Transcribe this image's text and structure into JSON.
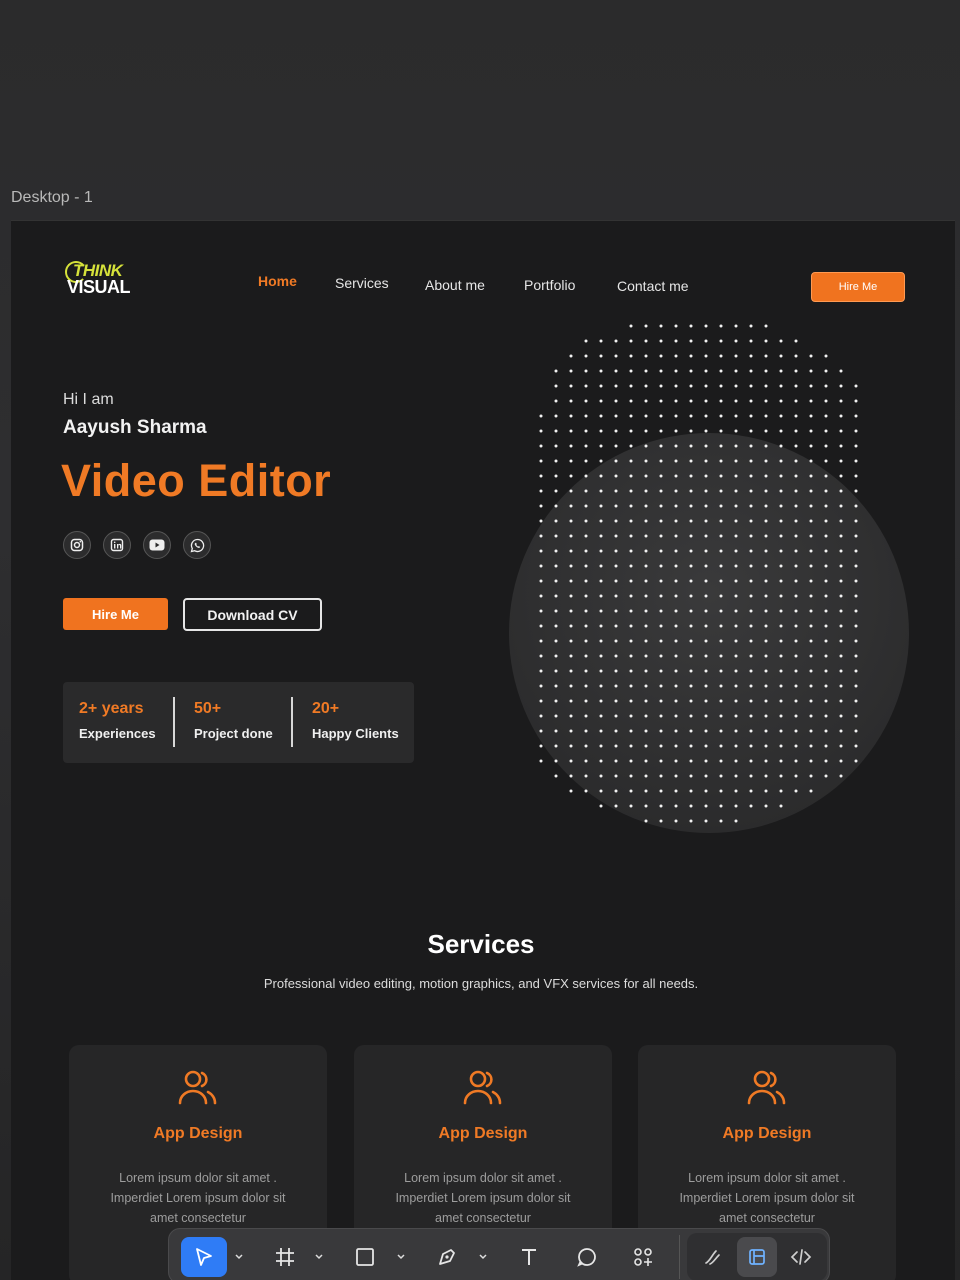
{
  "frame_label": "Desktop - 1",
  "logo": {
    "line1": "THINK",
    "line2": "VISUAL"
  },
  "nav": [
    "Home",
    "Services",
    "About me",
    "Portfolio",
    "Contact me"
  ],
  "hire_top_label": "Hire Me",
  "hero": {
    "greeting": "Hi I am",
    "name": "Aayush Sharma",
    "role": "Video Editor",
    "socials": [
      "instagram-icon",
      "linkedin-icon",
      "youtube-icon",
      "whatsapp-icon"
    ],
    "hire_label": "Hire Me",
    "cv_label": "Download CV"
  },
  "stats": [
    {
      "num": "2+ years",
      "label": "Experiences"
    },
    {
      "num": "50+",
      "label": "Project done"
    },
    {
      "num": "20+",
      "label": "Happy Clients"
    }
  ],
  "services": {
    "title": "Services",
    "subtitle": "Professional video editing, motion graphics, and VFX services for all needs.",
    "cards": [
      {
        "title": "App Design",
        "desc": "Lorem ipsum dolor sit amet . Imperdiet Lorem ipsum dolor sit amet consectetur"
      },
      {
        "title": "App Design",
        "desc": "Lorem ipsum dolor sit amet . Imperdiet Lorem ipsum dolor sit amet consectetur"
      },
      {
        "title": "App Design",
        "desc": "Lorem ipsum dolor sit amet . Imperdiet Lorem ipsum dolor sit amet consectetur"
      }
    ]
  },
  "toolbar": [
    "move-tool-icon",
    "frame-tool-icon",
    "rectangle-tool-icon",
    "pen-tool-icon",
    "text-tool-icon",
    "comment-tool-icon",
    "components-icon",
    "draw-mode-icon",
    "design-mode-icon",
    "dev-mode-icon"
  ],
  "colors": {
    "accent": "#f07a25",
    "background": "#1b1b1c",
    "card": "#262627"
  }
}
